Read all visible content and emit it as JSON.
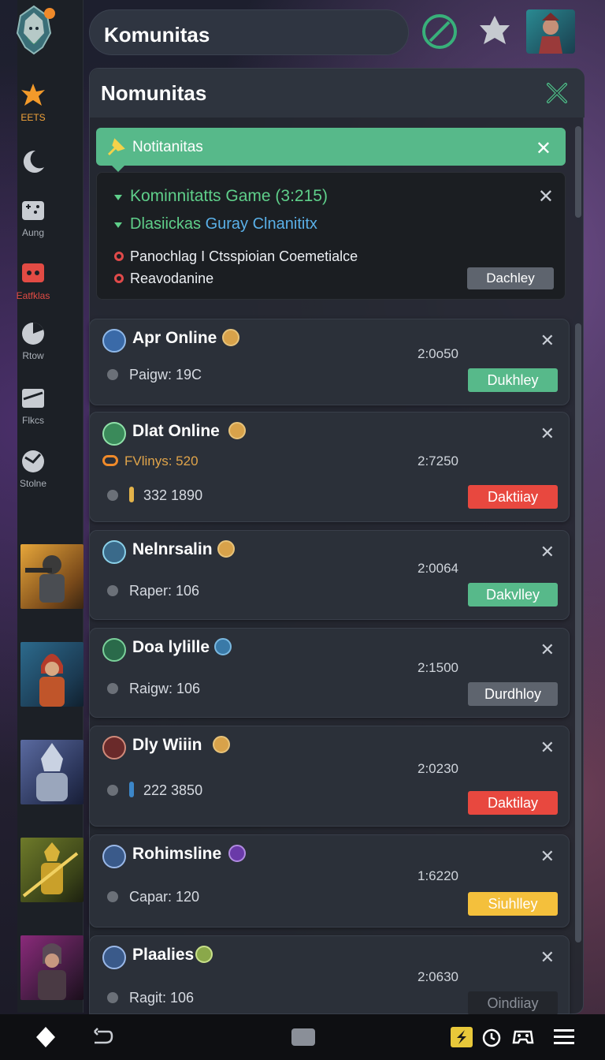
{
  "colors": {
    "green": "#57b98a",
    "red": "#e8483f",
    "yellow": "#f4c03c",
    "gray": "#5e646e",
    "accent_orange": "#f3a43a"
  },
  "sidebar": {
    "items": [
      {
        "label": "EETS",
        "icon": "flame-icon"
      },
      {
        "label": "",
        "icon": "moon-icon"
      },
      {
        "label": "Aung",
        "icon": "gamepad-icon"
      },
      {
        "label": "Eatfklas",
        "icon": "controller-icon"
      },
      {
        "label": "Rtow",
        "icon": "pie-chart-icon"
      },
      {
        "label": "Flkcs",
        "icon": "card-icon"
      },
      {
        "label": "Stolne",
        "icon": "globe-icon"
      }
    ]
  },
  "topbar": {
    "title": "Komunitas"
  },
  "panel": {
    "title": "Nomunitas"
  },
  "notification": {
    "text": "Notitanitas",
    "close": "✕"
  },
  "popup": {
    "line1": "Kominnitatts Game (3:215)",
    "line2_a": "Dlasiickas",
    "line2_b": "Guray Clnanititx",
    "line3": "Panochlag I   Ctsspioian Coemetialce",
    "line4": "Reavodanine",
    "close": "✕",
    "button": "Dachley"
  },
  "cards": [
    {
      "name": "Apr Online",
      "detail": "Paigw: 19C",
      "time": "2:0o50",
      "button": "Dukhley",
      "status": "green"
    },
    {
      "name": "Dlat Online",
      "sub": "FVlinys: 520",
      "detail": "332 1890",
      "time": "2:7250",
      "button": "Daktiiay",
      "status": "red"
    },
    {
      "name": "Nelnrsalin",
      "detail": "Raper: 106",
      "time": "2:0064",
      "button": "Dakvlley",
      "status": "green"
    },
    {
      "name": "Doa lylille",
      "detail": "Raigw: 106",
      "time": "2:1500",
      "button": "Durdhloy",
      "status": "gray"
    },
    {
      "name": "Dly Wiiin",
      "detail": "222 3850",
      "time": "2:0230",
      "button": "Daktilay",
      "status": "red"
    },
    {
      "name": "Rohimsline",
      "detail": "Capar: 120",
      "time": "1:6220",
      "button": "Siuhlley",
      "status": "yellow"
    },
    {
      "name": "Plaalies",
      "detail": "Ragit: 106",
      "time": "2:0630",
      "button": "Oindiiay",
      "status": "dark"
    }
  ],
  "card_close": "✕"
}
